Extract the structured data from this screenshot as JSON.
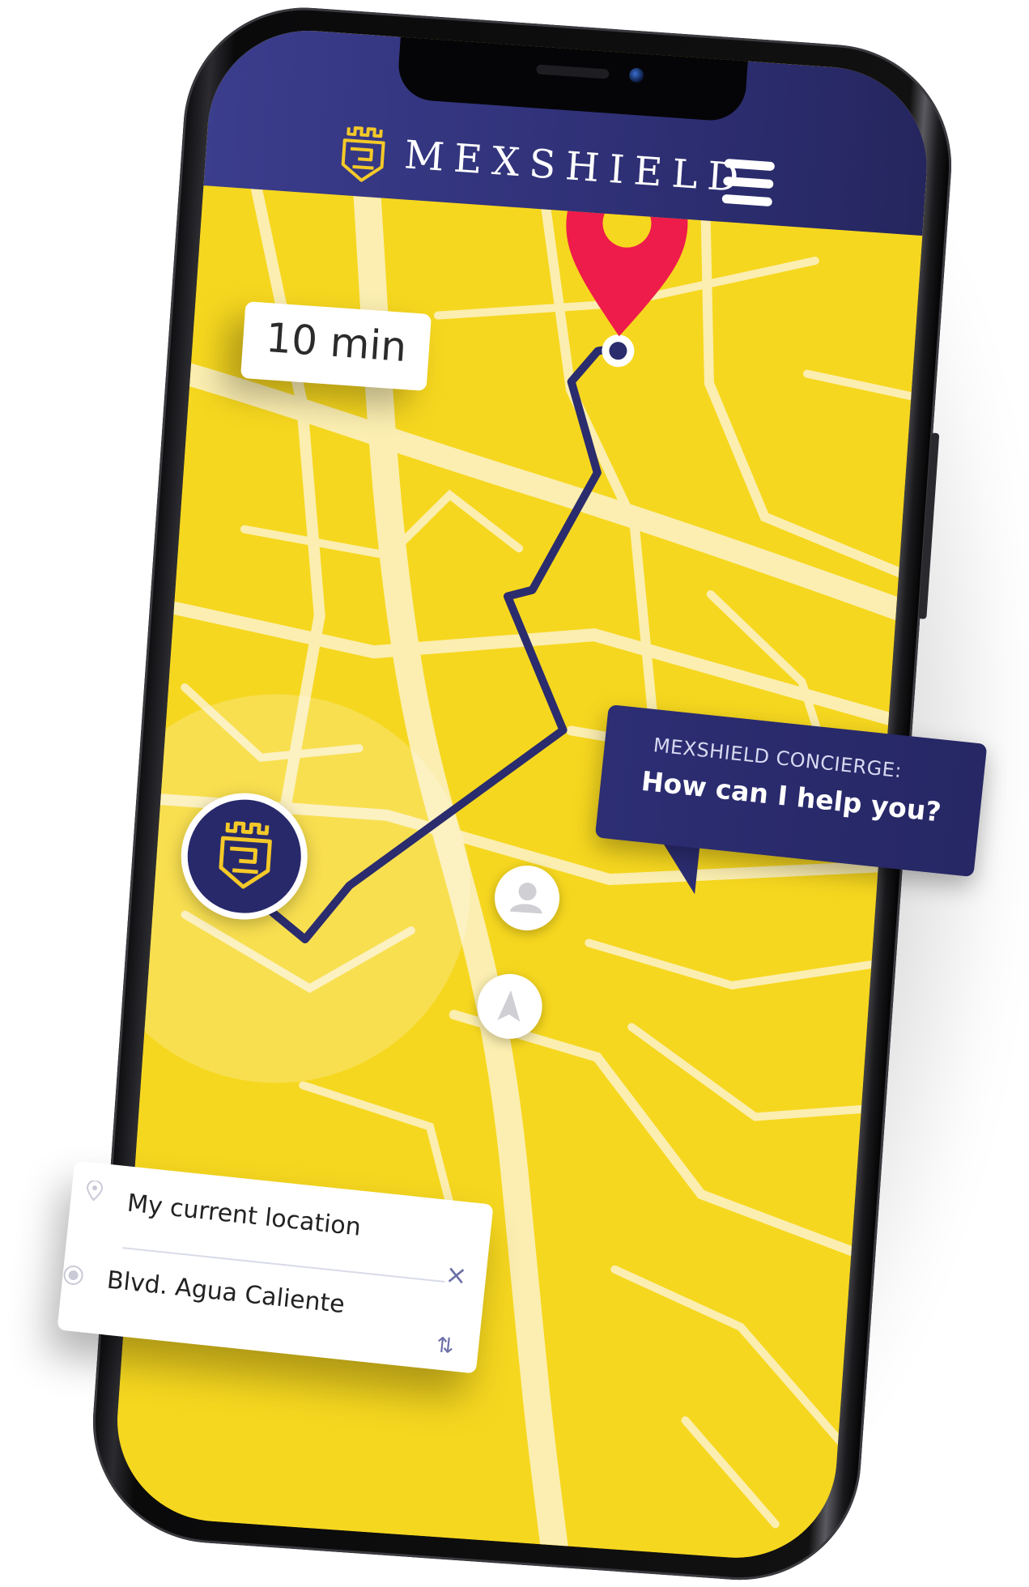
{
  "header": {
    "brand_title": "MEXSHIELD",
    "logo_icon": "castle-shield-logo-icon",
    "menu_icon": "hamburger-menu-icon"
  },
  "map": {
    "eta_label": "10 min",
    "destination_icon": "map-pin-icon",
    "user_location_icon": "castle-shield-logo-icon"
  },
  "actions": {
    "profile_icon": "person-icon",
    "navigate_icon": "navigation-arrow-icon"
  },
  "route": {
    "origin_label": "My current location",
    "destination_label": "Blvd. Agua Caliente",
    "origin_icon": "location-pin-outline-icon",
    "destination_icon": "radio-dot-icon",
    "clear_symbol": "×",
    "swap_symbol": "⇅"
  },
  "concierge": {
    "header": "MEXSHIELD CONCIERGE:",
    "message": "How can I help you?"
  },
  "colors": {
    "brand_navy": "#2c2d70",
    "map_yellow": "#f6d71f",
    "road": "#fbeeb0",
    "route_line": "#2b2c6d",
    "pin_red": "#ee1c4a",
    "logo_gold": "#f4c928"
  }
}
